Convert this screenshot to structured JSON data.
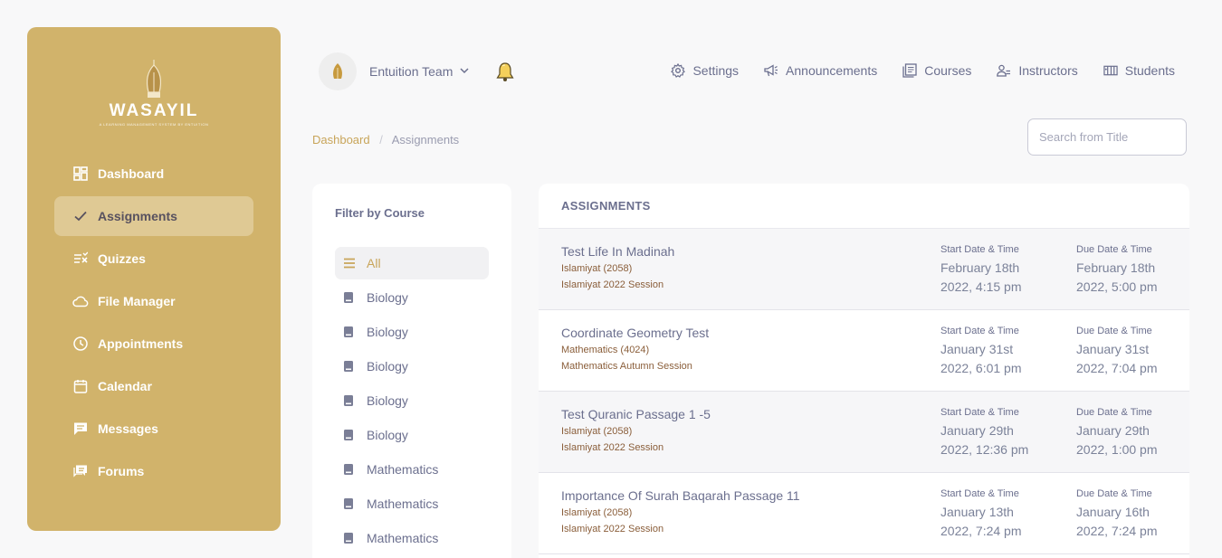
{
  "brand": {
    "name": "WASAYIL",
    "tagline": "A LEARNING MANAGEMENT SYSTEM BY ENTUITION",
    "color": "#d1b36b"
  },
  "sidebar": {
    "items": [
      {
        "label": "Dashboard",
        "icon": "dashboard-icon"
      },
      {
        "label": "Assignments",
        "icon": "check-icon"
      },
      {
        "label": "Quizzes",
        "icon": "quiz-icon"
      },
      {
        "label": "File Manager",
        "icon": "cloud-icon"
      },
      {
        "label": "Appointments",
        "icon": "clock-icon"
      },
      {
        "label": "Calendar",
        "icon": "calendar-icon"
      },
      {
        "label": "Messages",
        "icon": "message-icon"
      },
      {
        "label": "Forums",
        "icon": "forum-icon"
      }
    ]
  },
  "header": {
    "team": "Entuition Team",
    "nav": [
      {
        "label": "Settings",
        "icon": "gear-icon"
      },
      {
        "label": "Announcements",
        "icon": "megaphone-icon"
      },
      {
        "label": "Courses",
        "icon": "book-icon"
      },
      {
        "label": "Instructors",
        "icon": "users-icon"
      },
      {
        "label": "Students",
        "icon": "students-icon"
      }
    ]
  },
  "breadcrumb": {
    "home": "Dashboard",
    "sep": "/",
    "current": "Assignments"
  },
  "search": {
    "placeholder": "Search from Title"
  },
  "filter": {
    "title": "Filter by Course",
    "items": [
      "All",
      "Biology",
      "Biology",
      "Biology",
      "Biology",
      "Biology",
      "Mathematics",
      "Mathematics",
      "Mathematics"
    ]
  },
  "assignments": {
    "heading": "ASSIGNMENTS",
    "start_label": "Start Date & Time",
    "due_label": "Due Date & Time",
    "rows": [
      {
        "title": "Test Life In Madinah",
        "course": "Islamiyat (2058)",
        "session": "Islamiyat 2022 Session",
        "start": [
          "February 18th",
          "2022, 4:15 pm"
        ],
        "due": [
          "February 18th",
          "2022, 5:00 pm"
        ]
      },
      {
        "title": "Coordinate Geometry Test",
        "course": "Mathematics (4024)",
        "session": "Mathematics Autumn Session",
        "start": [
          "January 31st",
          "2022, 6:01 pm"
        ],
        "due": [
          "January 31st",
          "2022, 7:04 pm"
        ]
      },
      {
        "title": "Test Quranic Passage 1 -5",
        "course": "Islamiyat (2058)",
        "session": "Islamiyat 2022 Session",
        "start": [
          "January 29th",
          "2022, 12:36 pm"
        ],
        "due": [
          "January 29th",
          "2022, 1:00 pm"
        ]
      },
      {
        "title": "Importance Of Surah Baqarah Passage 11",
        "course": "Islamiyat (2058)",
        "session": "Islamiyat 2022 Session",
        "start": [
          "January 13th",
          "2022, 7:24 pm"
        ],
        "due": [
          "January 16th",
          "2022, 7:24 pm"
        ]
      }
    ]
  }
}
